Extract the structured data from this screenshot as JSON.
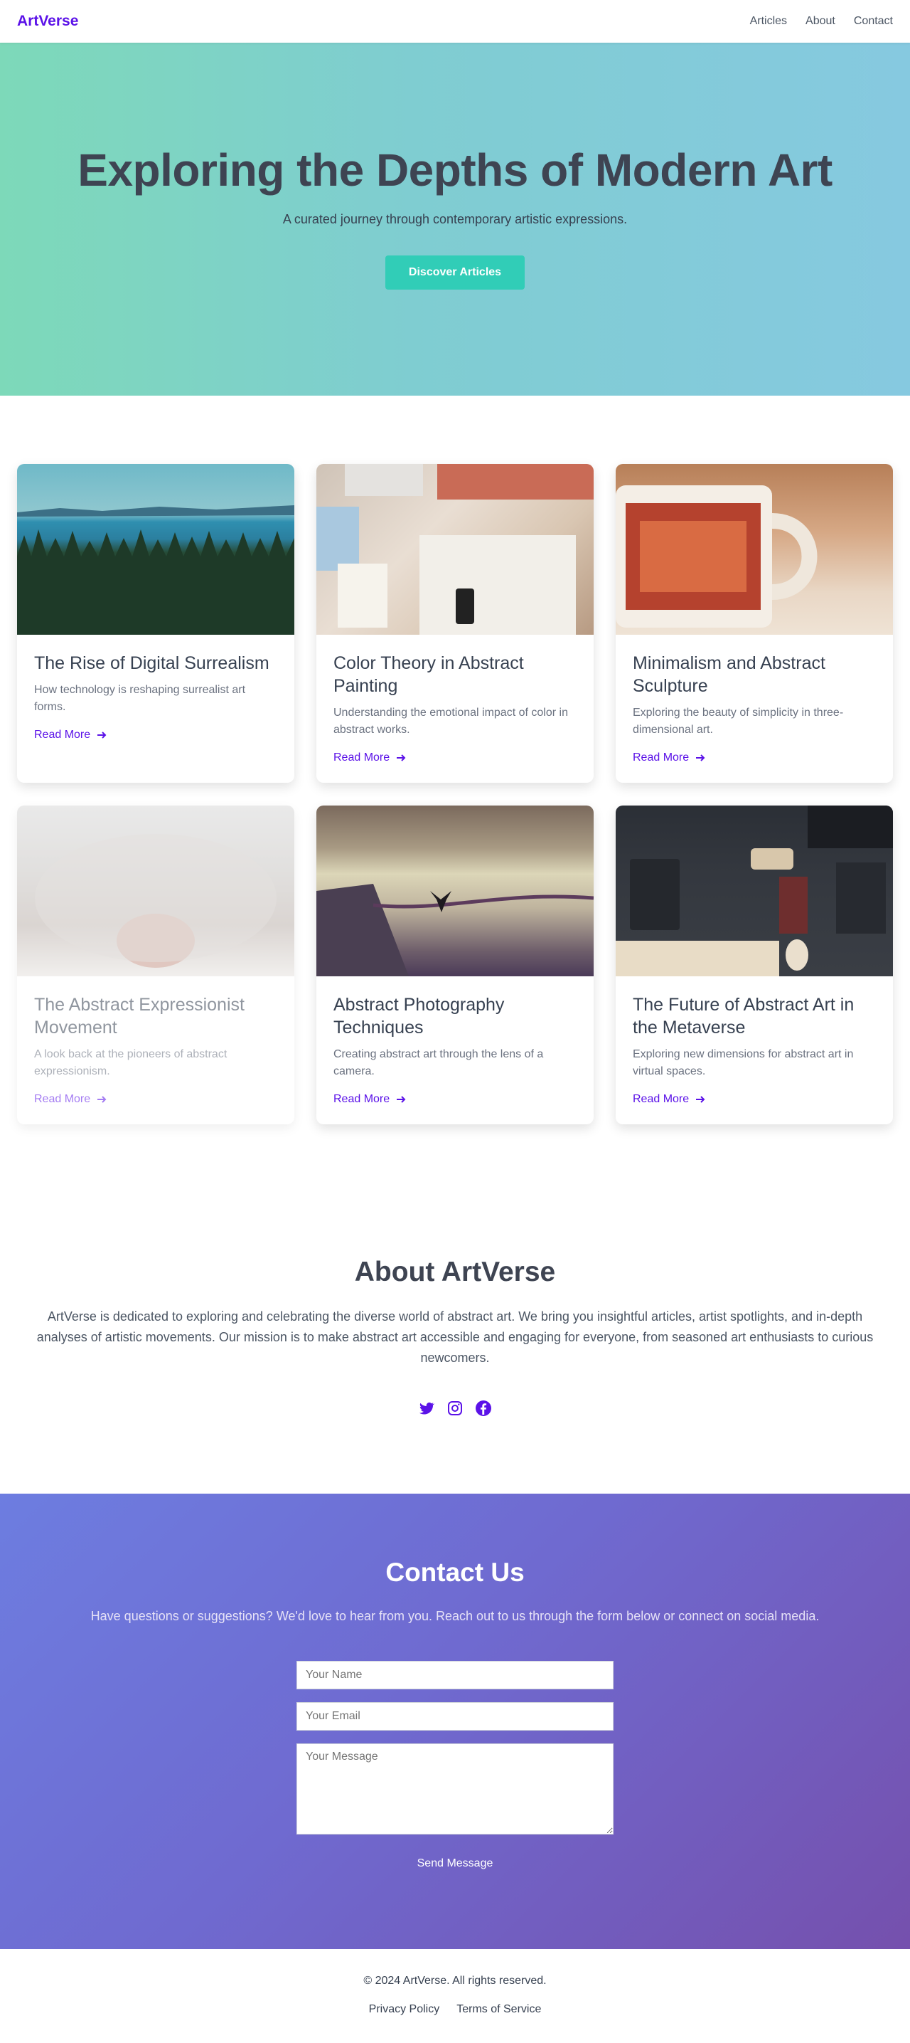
{
  "header": {
    "brand": "ArtVerse",
    "nav": [
      "Articles",
      "About",
      "Contact"
    ]
  },
  "hero": {
    "title": "Exploring the Depths of Modern Art",
    "subtitle": "A curated journey through contemporary artistic expressions.",
    "cta": "Discover Articles"
  },
  "cards": [
    {
      "title": "The Rise of Digital Surrealism",
      "description": "How technology is reshaping surrealist art forms.",
      "link": "Read More",
      "image": "forest-lake-photo"
    },
    {
      "title": "Color Theory in Abstract Painting",
      "description": "Understanding the emotional impact of color in abstract works.",
      "link": "Read More",
      "image": "desk-books-photo"
    },
    {
      "title": "Minimalism and Abstract Sculpture",
      "description": "Exploring the beauty of simplicity in three-dimensional art.",
      "link": "Read More",
      "image": "red-mug-photo"
    },
    {
      "title": "The Abstract Expressionist Movement",
      "description": "A look back at the pioneers of abstract expressionism.",
      "link": "Read More",
      "image": "cat-nose-photo"
    },
    {
      "title": "Abstract Photography Techniques",
      "description": "Creating abstract art through the lens of a camera.",
      "link": "Read More",
      "image": "pier-bird-photo"
    },
    {
      "title": "The Future of Abstract Art in the Metaverse",
      "description": "Exploring new dimensions for abstract art in virtual spaces.",
      "link": "Read More",
      "image": "tech-desk-photo"
    }
  ],
  "about": {
    "title": "About ArtVerse",
    "text": "ArtVerse is dedicated to exploring and celebrating the diverse world of abstract art. We bring you insightful articles, artist spotlights, and in-depth analyses of artistic movements. Our mission is to make abstract art accessible and engaging for everyone, from seasoned art enthusiasts to curious newcomers.",
    "social_icons": [
      "twitter-icon",
      "instagram-icon",
      "facebook-icon"
    ]
  },
  "contact": {
    "title": "Contact Us",
    "lead": "Have questions or suggestions? We'd love to hear from you. Reach out to us through the form below or connect on social media.",
    "name_placeholder": "Your Name",
    "email_placeholder": "Your Email",
    "message_placeholder": "Your Message",
    "send": "Send Message"
  },
  "footer": {
    "copyright": "© 2024 ArtVerse. All rights reserved.",
    "links": [
      "Privacy Policy",
      "Terms of Service"
    ]
  },
  "colors": {
    "accent": "#5b12e8",
    "cta": "#31cdb7",
    "heading": "#3e4452"
  }
}
